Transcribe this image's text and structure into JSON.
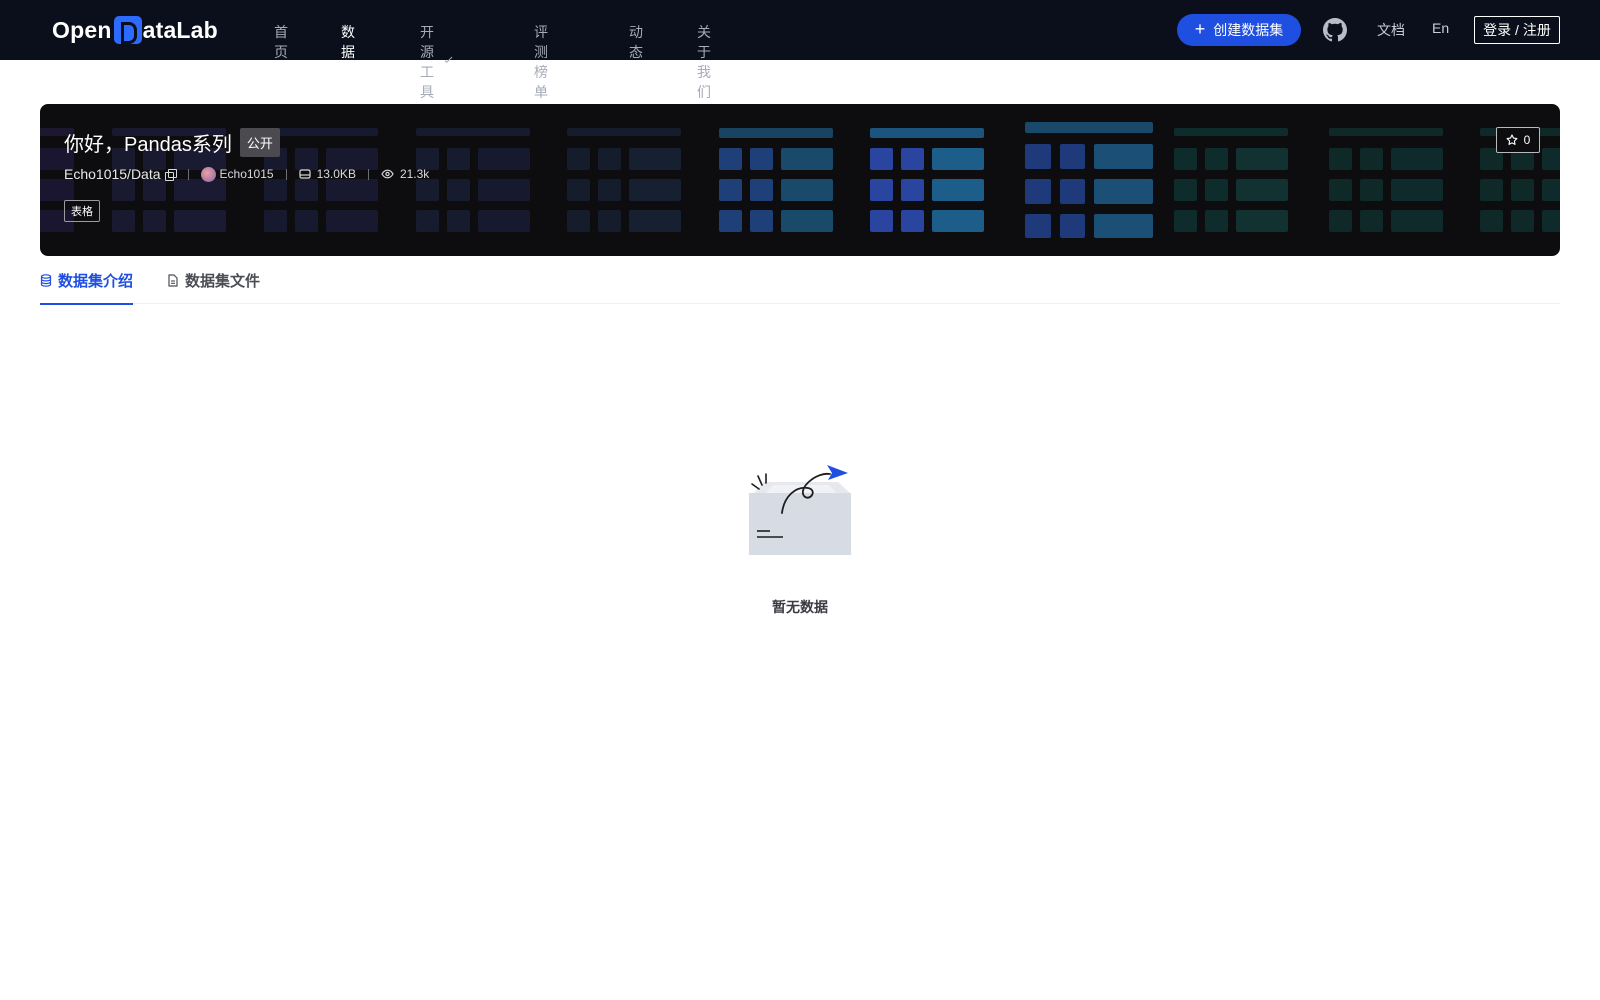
{
  "nav": {
    "logo_text_left": "Open",
    "logo_text_right": "ataLab",
    "links": [
      {
        "label": "首页",
        "active": false
      },
      {
        "label": "数据集",
        "active": true
      },
      {
        "label": "开源工具",
        "active": false,
        "dropdown": true
      },
      {
        "label": "评测榜单",
        "active": false
      },
      {
        "label": "动态",
        "active": false
      },
      {
        "label": "关于我们",
        "active": false
      }
    ],
    "create_label": "创建数据集",
    "docs_label": "文档",
    "lang_label": "En",
    "login_label": "登录 / 注册"
  },
  "dataset": {
    "title": "你好，Pandas系列",
    "visibility": "公开",
    "path": "Echo1015/Data",
    "owner": "Echo1015",
    "size": "13.0KB",
    "views": "21.3k",
    "tag": "表格",
    "stars": "0"
  },
  "tabs": [
    {
      "label": "数据集介绍",
      "active": true,
      "icon": "database-icon"
    },
    {
      "label": "数据集文件",
      "active": false,
      "icon": "file-icon"
    }
  ],
  "empty": {
    "text": "暂无数据"
  },
  "colors": {
    "nav_bg": "#0b0f1c",
    "accent": "#1e4fe0",
    "banner_bg": "#0d0d10"
  }
}
